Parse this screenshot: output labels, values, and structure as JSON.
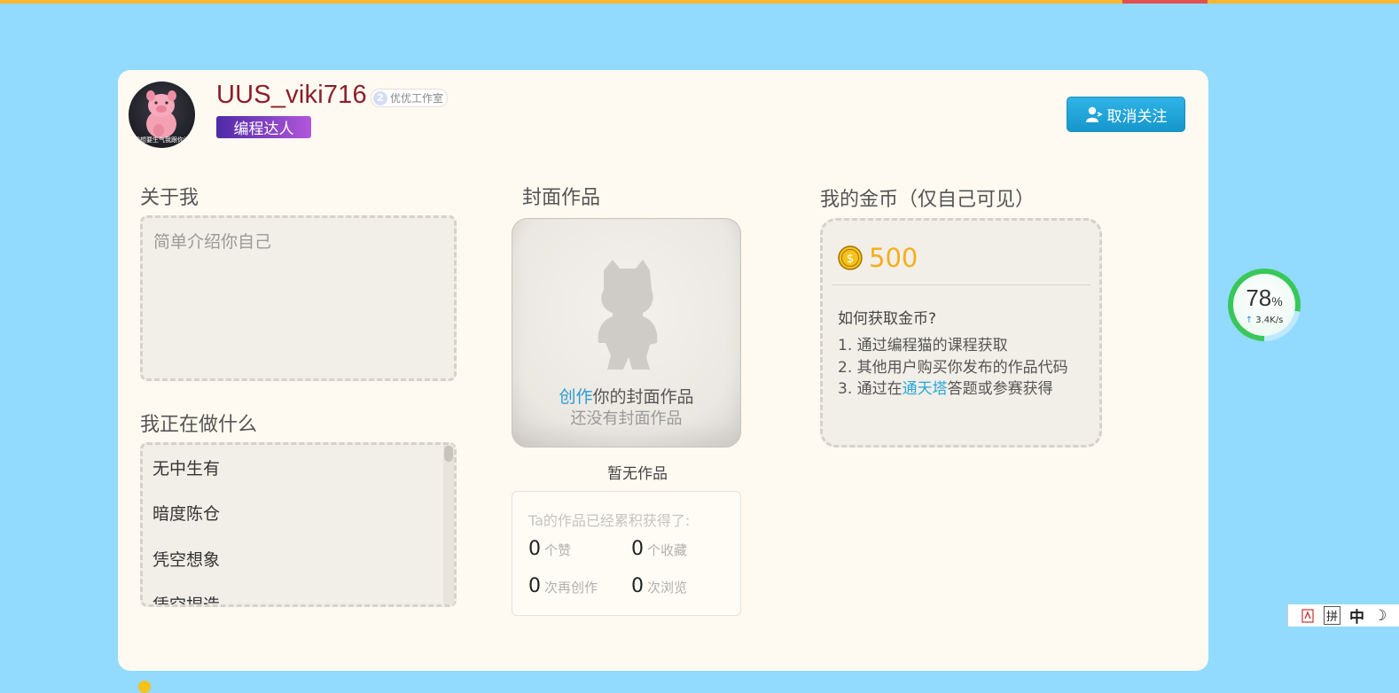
{
  "profile": {
    "username": "UUS_viki716",
    "studio_badge_number": "2",
    "studio_name": "优优工作室",
    "tag": "编程达人",
    "avatar_text": "我想要生气我跟你说",
    "unfollow_label": "取消关注"
  },
  "about": {
    "title": "关于我",
    "placeholder": "简单介绍你自己"
  },
  "doing": {
    "title": "我正在做什么",
    "items": [
      "无中生有",
      "暗度陈仓",
      "凭空想象",
      "凭空捏造"
    ]
  },
  "cover": {
    "title": "封面作品",
    "create_link": "创作",
    "create_rest": "你的封面作品",
    "empty_text": "还没有封面作品",
    "no_works": "暂无作品"
  },
  "stats": {
    "title": "Ta的作品已经累积获得了:",
    "likes": {
      "value": "0",
      "label": "个赞"
    },
    "favorites": {
      "value": "0",
      "label": "个收藏"
    },
    "recreations": {
      "value": "0",
      "label": "次再创作"
    },
    "views": {
      "value": "0",
      "label": "次浏览"
    }
  },
  "coins": {
    "title": "我的金币（仅自己可见）",
    "amount": "500",
    "how_title": "如何获取金币?",
    "step1": "1. 通过编程猫的课程获取",
    "step2": "2. 其他用户购买你发布的作品代码",
    "step3_prefix": "3. 通过在",
    "step3_link": "通天塔",
    "step3_suffix": "答题或参赛获得"
  },
  "speed_widget": {
    "percent": "78",
    "percent_sign": "%",
    "rate": "3.4K/s",
    "progress": 0.78
  },
  "ime_bar": {
    "pinyin": "拼",
    "lang": "中"
  },
  "icons": {
    "user": "user-icon",
    "coin": "coin-icon",
    "cover_character": "character-silhouette-icon",
    "upload_arrow": "arrow-up-icon"
  },
  "colors": {
    "background": "#92dbfe",
    "card": "#fffaf1",
    "username": "#8a1f2a",
    "tag_start": "#4f2aa7",
    "tag_end": "#b257db",
    "button": "#1ea6da",
    "coin": "#f5ae1c",
    "link": "#2a9cd2"
  }
}
